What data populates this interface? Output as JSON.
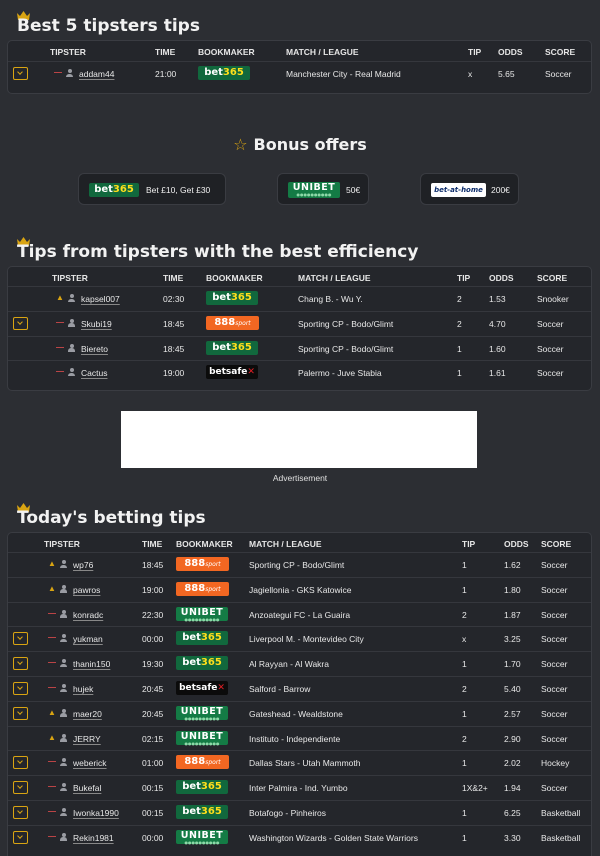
{
  "best5": {
    "title": "Best 5 tipsters tips",
    "headers": {
      "tipster": "TIPSTER",
      "time": "TIME",
      "bookmaker": "BOOKMAKER",
      "match": "MATCH / LEAGUE",
      "tip": "TIP",
      "odds": "ODDS",
      "score": "SCORE"
    },
    "rows": [
      {
        "expand": true,
        "trend": "down",
        "tipster": "addam44",
        "time": "21:00",
        "bookmaker": "bet365",
        "match": "Manchester City - Real Madrid",
        "tip": "x",
        "odds": "5.65",
        "score": "Soccer"
      }
    ]
  },
  "bonus": {
    "title": "Bonus offers",
    "offers": [
      {
        "bookmaker": "bet365",
        "text": "Bet £10, Get £30"
      },
      {
        "bookmaker": "unibet",
        "text": "50€"
      },
      {
        "bookmaker": "bet-at-home",
        "text": "200€"
      }
    ]
  },
  "efficiency": {
    "title": "Tips from tipsters with the best efficiency",
    "headers": {
      "tipster": "TIPSTER",
      "time": "TIME",
      "bookmaker": "BOOKMAKER",
      "match": "MATCH / LEAGUE",
      "tip": "TIP",
      "odds": "ODDS",
      "score": "SCORE"
    },
    "rows": [
      {
        "expand": false,
        "trend": "up",
        "tipster": "kapsel007",
        "time": "02:30",
        "bookmaker": "bet365",
        "match": "Chang B. - Wu Y.",
        "tip": "2",
        "odds": "1.53",
        "score": "Snooker"
      },
      {
        "expand": true,
        "trend": "down",
        "tipster": "Skubi19",
        "time": "18:45",
        "bookmaker": "888sport",
        "match": "Sporting CP - Bodo/Glimt",
        "tip": "2",
        "odds": "4.70",
        "score": "Soccer"
      },
      {
        "expand": false,
        "trend": "down",
        "tipster": "Biereto",
        "time": "18:45",
        "bookmaker": "bet365",
        "match": "Sporting CP - Bodo/Glimt",
        "tip": "1",
        "odds": "1.60",
        "score": "Soccer"
      },
      {
        "expand": false,
        "trend": "down",
        "tipster": "Cactus",
        "time": "19:00",
        "bookmaker": "betsafe",
        "match": "Palermo - Juve Stabia",
        "tip": "1",
        "odds": "1.61",
        "score": "Soccer"
      }
    ]
  },
  "ad": {
    "label": "Advertisement"
  },
  "today": {
    "title": "Today's betting tips",
    "headers": {
      "tipster": "TIPSTER",
      "time": "TIME",
      "bookmaker": "BOOKMAKER",
      "match": "MATCH / LEAGUE",
      "tip": "TIP",
      "odds": "ODDS",
      "score": "SCORE"
    },
    "rows": [
      {
        "expand": false,
        "trend": "up",
        "tipster": "wp76",
        "time": "18:45",
        "bookmaker": "888sport",
        "match": "Sporting CP - Bodo/Glimt",
        "tip": "1",
        "odds": "1.62",
        "score": "Soccer"
      },
      {
        "expand": false,
        "trend": "up",
        "tipster": "pawros",
        "time": "19:00",
        "bookmaker": "888sport",
        "match": "Jagiellonia - GKS Katowice",
        "tip": "1",
        "odds": "1.80",
        "score": "Soccer"
      },
      {
        "expand": false,
        "trend": "down",
        "tipster": "konradc",
        "time": "22:30",
        "bookmaker": "unibet",
        "match": "Anzoategui FC - La Guaira",
        "tip": "2",
        "odds": "1.87",
        "score": "Soccer"
      },
      {
        "expand": true,
        "trend": "down",
        "tipster": "yukman",
        "time": "00:00",
        "bookmaker": "bet365",
        "match": "Liverpool M. - Montevideo City",
        "tip": "x",
        "odds": "3.25",
        "score": "Soccer"
      },
      {
        "expand": true,
        "trend": "down",
        "tipster": "thanin150",
        "time": "19:30",
        "bookmaker": "bet365",
        "match": "Al Rayyan - Al Wakra",
        "tip": "1",
        "odds": "1.70",
        "score": "Soccer"
      },
      {
        "expand": true,
        "trend": "down",
        "tipster": "hujek",
        "time": "20:45",
        "bookmaker": "betsafe",
        "match": "Salford - Barrow",
        "tip": "2",
        "odds": "5.40",
        "score": "Soccer"
      },
      {
        "expand": true,
        "trend": "up",
        "tipster": "maer20",
        "time": "20:45",
        "bookmaker": "unibet",
        "match": "Gateshead - Wealdstone",
        "tip": "1",
        "odds": "2.57",
        "score": "Soccer"
      },
      {
        "expand": false,
        "trend": "up",
        "tipster": "JERRY",
        "time": "02:15",
        "bookmaker": "unibet",
        "match": "Instituto - Independiente",
        "tip": "2",
        "odds": "2.90",
        "score": "Soccer"
      },
      {
        "expand": true,
        "trend": "down",
        "tipster": "weberick",
        "time": "01:00",
        "bookmaker": "888sport",
        "match": "Dallas Stars - Utah Mammoth",
        "tip": "1",
        "odds": "2.02",
        "score": "Hockey"
      },
      {
        "expand": true,
        "trend": "down",
        "tipster": "Bukefal",
        "time": "00:15",
        "bookmaker": "bet365",
        "match": "Inter Palmira - Ind. Yumbo",
        "tip": "1X&2+",
        "odds": "1.94",
        "score": "Soccer"
      },
      {
        "expand": true,
        "trend": "down",
        "tipster": "Iwonka1990",
        "time": "00:15",
        "bookmaker": "bet365",
        "match": "Botafogo - Pinheiros",
        "tip": "1",
        "odds": "6.25",
        "score": "Basketball"
      },
      {
        "expand": true,
        "trend": "down",
        "tipster": "Rekin1981",
        "time": "00:00",
        "bookmaker": "unibet",
        "match": "Washington Wizards - Golden State Warriors",
        "tip": "1",
        "odds": "3.30",
        "score": "Basketball"
      }
    ]
  },
  "colors": {
    "background": "#2c2e33",
    "panel": "#24262b",
    "accent": "#d9a412",
    "trend_down": "#d84b4b"
  }
}
